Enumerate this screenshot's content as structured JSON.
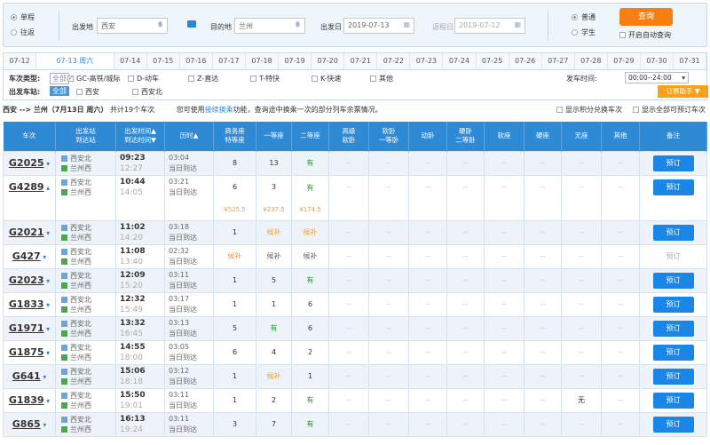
{
  "search": {
    "trip_types": [
      "单程",
      "往返"
    ],
    "from_label": "出发地",
    "from_value": "西安",
    "to_label": "目的地",
    "to_value": "兰州",
    "depart_label": "出发日",
    "depart_value": "2019-07-13",
    "return_label": "返程日",
    "return_value": "2019-07-12",
    "passenger_types": [
      "普通",
      "学生"
    ],
    "query_label": "查询",
    "auto_query_label": "开启自动查询"
  },
  "dates": [
    "07-12",
    "07-13 周六",
    "07-14",
    "07-15",
    "07-16",
    "07-17",
    "07-18",
    "07-19",
    "07-20",
    "07-21",
    "07-22",
    "07-23",
    "07-24",
    "07-25",
    "07-26",
    "07-27",
    "07-28",
    "07-29",
    "07-30",
    "07-31"
  ],
  "filters": {
    "type_label": "车次类型:",
    "all": "全部",
    "types": [
      "GC-高铁/城际",
      "D-动车",
      "Z-直达",
      "T-特快",
      "K-快速",
      "其他"
    ],
    "station_label": "出发车站:",
    "stations": [
      "西安",
      "西安北"
    ],
    "time_label": "发车时间:",
    "time_value": "00:00--24:00",
    "helper_label": "订票助手 ▼"
  },
  "info": {
    "route": "西安 --> 兰州（7月13日  周六）",
    "count": "共计19个车次",
    "tip_pre": "您可使用",
    "tip_link": "接续换乘",
    "tip_post": "功能，查询途中换乘一次的部分列车余票情况。",
    "opt1": "显示积分兑换车次",
    "opt2": "显示全部可预订车次"
  },
  "headers": [
    "车次",
    "出发站\n到达站",
    "出发时间▲\n到达时间▼",
    "历时▲",
    "商务座\n特等座",
    "一等座",
    "二等座",
    "高级\n软卧",
    "软卧\n一等卧",
    "动卧",
    "硬卧\n二等卧",
    "软座",
    "硬座",
    "无座",
    "其他",
    "备注"
  ],
  "colors": {
    "accent": "#2f8ad6",
    "button": "#1a86e8",
    "query": "#f77f12",
    "available": "#2a9b2a",
    "waitlist": "#f0a030"
  },
  "trains": [
    {
      "no": "G2025",
      "from": "西安北",
      "to": "兰州西",
      "dep": "09:23",
      "arr": "12:27",
      "dur": "03:04",
      "day": "当日到达",
      "seats": [
        "8",
        "13",
        "有",
        "--",
        "--",
        "--",
        "--",
        "--",
        "--",
        "--",
        "--"
      ],
      "book": "预订",
      "bookable": true
    },
    {
      "no": "G4289",
      "from": "西安北",
      "to": "兰州西",
      "dep": "10:44",
      "arr": "14:05",
      "dur": "03:21",
      "day": "当日到达",
      "seats": [
        "6",
        "3",
        "有",
        "--",
        "--",
        "--",
        "--",
        "--",
        "--",
        "--",
        "--"
      ],
      "book": "预订",
      "bookable": true,
      "prices": [
        "¥525.5",
        "¥237.5",
        "¥174.5"
      ],
      "expanded": true
    },
    {
      "no": "G2021",
      "from": "西安北",
      "to": "兰州西",
      "dep": "11:02",
      "arr": "14:20",
      "dur": "03:18",
      "day": "当日到达",
      "seats": [
        "1",
        "候补",
        "候补",
        "--",
        "--",
        "--",
        "--",
        "--",
        "--",
        "--",
        "--"
      ],
      "book": "预订",
      "bookable": true
    },
    {
      "no": "G427",
      "from": "西安北",
      "to": "兰州西",
      "dep": "11:08",
      "arr": "13:40",
      "dur": "02:32",
      "day": "当日到达",
      "seats": [
        "候补",
        "候补",
        "候补",
        "--",
        "--",
        "--",
        "--",
        "--",
        "--",
        "--",
        "--"
      ],
      "book": "预订",
      "bookable": false
    },
    {
      "no": "G2023",
      "from": "西安北",
      "to": "兰州西",
      "dep": "12:09",
      "arr": "15:20",
      "dur": "03:11",
      "day": "当日到达",
      "seats": [
        "1",
        "5",
        "有",
        "--",
        "--",
        "--",
        "--",
        "--",
        "--",
        "--",
        "--"
      ],
      "book": "预订",
      "bookable": true
    },
    {
      "no": "G1833",
      "from": "西安北",
      "to": "兰州西",
      "dep": "12:32",
      "arr": "15:49",
      "dur": "03:17",
      "day": "当日到达",
      "seats": [
        "1",
        "1",
        "6",
        "--",
        "--",
        "--",
        "--",
        "--",
        "--",
        "--",
        "--"
      ],
      "book": "预订",
      "bookable": true
    },
    {
      "no": "G1971",
      "from": "西安北",
      "to": "兰州西",
      "dep": "13:32",
      "arr": "16:45",
      "dur": "03:13",
      "day": "当日到达",
      "seats": [
        "5",
        "有",
        "6",
        "--",
        "--",
        "--",
        "--",
        "--",
        "--",
        "--",
        "--"
      ],
      "book": "预订",
      "bookable": true
    },
    {
      "no": "G1875",
      "from": "西安北",
      "to": "兰州西",
      "dep": "14:55",
      "arr": "18:00",
      "dur": "03:05",
      "day": "当日到达",
      "seats": [
        "6",
        "4",
        "2",
        "--",
        "--",
        "--",
        "--",
        "--",
        "--",
        "--",
        "--"
      ],
      "book": "预订",
      "bookable": true
    },
    {
      "no": "G641",
      "from": "西安北",
      "to": "兰州西",
      "dep": "15:06",
      "arr": "18:18",
      "dur": "03:12",
      "day": "当日到达",
      "seats": [
        "1",
        "候补",
        "1",
        "--",
        "--",
        "--",
        "--",
        "--",
        "--",
        "--",
        "--"
      ],
      "book": "预订",
      "bookable": true
    },
    {
      "no": "G1839",
      "from": "西安北",
      "to": "兰州西",
      "dep": "15:50",
      "arr": "19:01",
      "dur": "03:11",
      "day": "当日到达",
      "seats": [
        "1",
        "2",
        "有",
        "--",
        "--",
        "--",
        "--",
        "--",
        "--",
        "无",
        "--"
      ],
      "book": "预订",
      "bookable": true
    },
    {
      "no": "G865",
      "from": "西安北",
      "to": "兰州西",
      "dep": "16:13",
      "arr": "19:24",
      "dur": "03:11",
      "day": "当日到达",
      "seats": [
        "3",
        "7",
        "有",
        "--",
        "--",
        "--",
        "--",
        "--",
        "--",
        "--",
        "--"
      ],
      "book": "预订",
      "bookable": true
    }
  ]
}
